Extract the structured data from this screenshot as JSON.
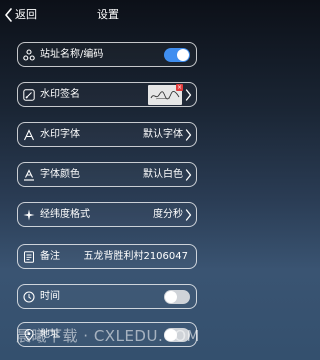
{
  "header": {
    "back_label": "返回",
    "title": "设置"
  },
  "rows": [
    {
      "label": "站址名称/编码",
      "icon": "sitemap-icon",
      "control": "toggle",
      "toggle_on": true
    },
    {
      "label": "水印签名",
      "icon": "signature-pen-icon",
      "control": "signature-thumbnail"
    },
    {
      "label": "水印字体",
      "icon": "font-icon",
      "value": "默认字体",
      "control": "chevron"
    },
    {
      "label": "字体颜色",
      "icon": "font-color-icon",
      "value": "默认白色",
      "control": "chevron"
    },
    {
      "label": "经纬度格式",
      "icon": "compass-icon",
      "value": "度分秒",
      "control": "chevron"
    },
    {
      "label": "备注",
      "icon": "note-icon",
      "value": "五龙背胜利村2106047"
    },
    {
      "label": "时间",
      "icon": "clock-icon",
      "control": "toggle",
      "toggle_on": false
    },
    {
      "label": "地址",
      "icon": "location-icon",
      "control": "toggle",
      "toggle_on": false
    }
  ],
  "watermark": "晨曦下载 · CXLEDU.COM",
  "colors": {
    "toggle_on": "#3f8ef0",
    "toggle_off": "#cfd3d8",
    "signature_close": "#e23b3b"
  }
}
